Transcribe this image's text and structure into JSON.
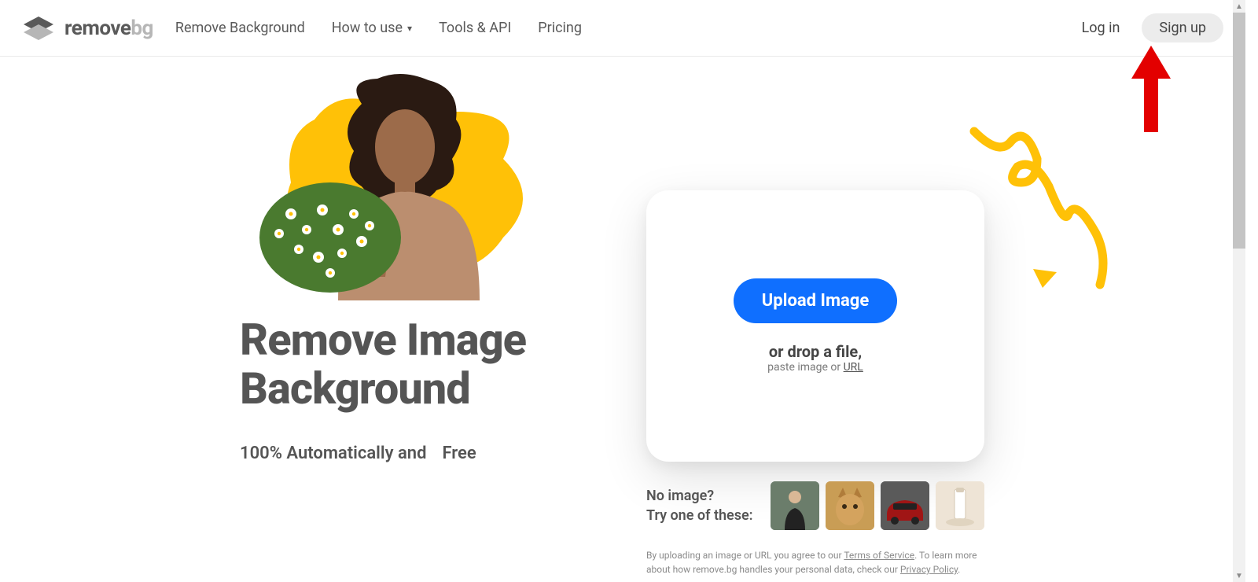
{
  "nav": {
    "logo_text1": "remove",
    "logo_text2": "bg",
    "links": {
      "remove_bg": "Remove Background",
      "how_to_use": "How to use",
      "tools_api": "Tools & API",
      "pricing": "Pricing"
    },
    "auth": {
      "login": "Log in",
      "signup": "Sign up"
    }
  },
  "hero": {
    "headline_l1": "Remove Image",
    "headline_l2": "Background",
    "sub_prefix": "100% Automatically and",
    "sub_free": "Free"
  },
  "upload": {
    "button": "Upload Image",
    "drop": "or drop a file,",
    "paste_prefix": "paste image or ",
    "url_label": "URL"
  },
  "samples": {
    "line1": "No image?",
    "line2": "Try one of these:"
  },
  "legal": {
    "t1": "By uploading an image or URL you agree to our ",
    "tos": "Terms of Service",
    "t2": ". To learn more about how remove.bg handles your personal data, check our ",
    "pp": "Privacy Policy",
    "t3": "."
  }
}
